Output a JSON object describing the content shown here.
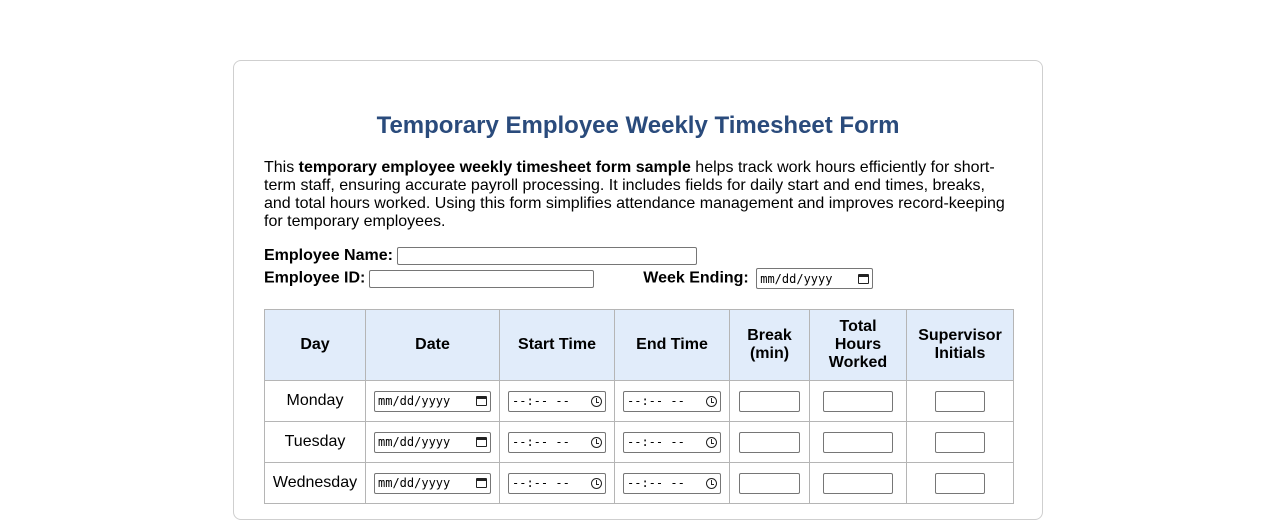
{
  "form": {
    "title": "Temporary Employee Weekly Timesheet Form",
    "intro_prefix": "This ",
    "intro_bold": "temporary employee weekly timesheet form sample",
    "intro_suffix": " helps track work hours efficiently for short-term staff, ensuring accurate payroll processing. It includes fields for daily start and end times, breaks, and total hours worked. Using this form simplifies attendance management and improves record-keeping for temporary employees."
  },
  "fields": {
    "employee_name_label": "Employee Name:",
    "employee_name_value": "",
    "employee_id_label": "Employee ID:",
    "employee_id_value": "",
    "week_ending_label": "Week Ending:",
    "week_ending_placeholder": "mm/dd/yyyy"
  },
  "table": {
    "headers": {
      "day": "Day",
      "date": "Date",
      "start_time": "Start Time",
      "end_time": "End Time",
      "break_line1": "Break",
      "break_line2": "(min)",
      "total_line1": "Total",
      "total_line2": "Hours",
      "total_line3": "Worked",
      "supervisor_line1": "Supervisor",
      "supervisor_line2": "Initials"
    },
    "rows": [
      {
        "day": "Monday",
        "date_placeholder": "mm/dd/yyyy",
        "start_placeholder": "--:-- --",
        "end_placeholder": "--:-- --"
      },
      {
        "day": "Tuesday",
        "date_placeholder": "mm/dd/yyyy",
        "start_placeholder": "--:-- --",
        "end_placeholder": "--:-- --"
      },
      {
        "day": "Wednesday",
        "date_placeholder": "mm/dd/yyyy",
        "start_placeholder": "--:-- --",
        "end_placeholder": "--:-- --"
      }
    ]
  },
  "icons": {
    "date": "calendar-icon",
    "time": "clock-icon"
  }
}
